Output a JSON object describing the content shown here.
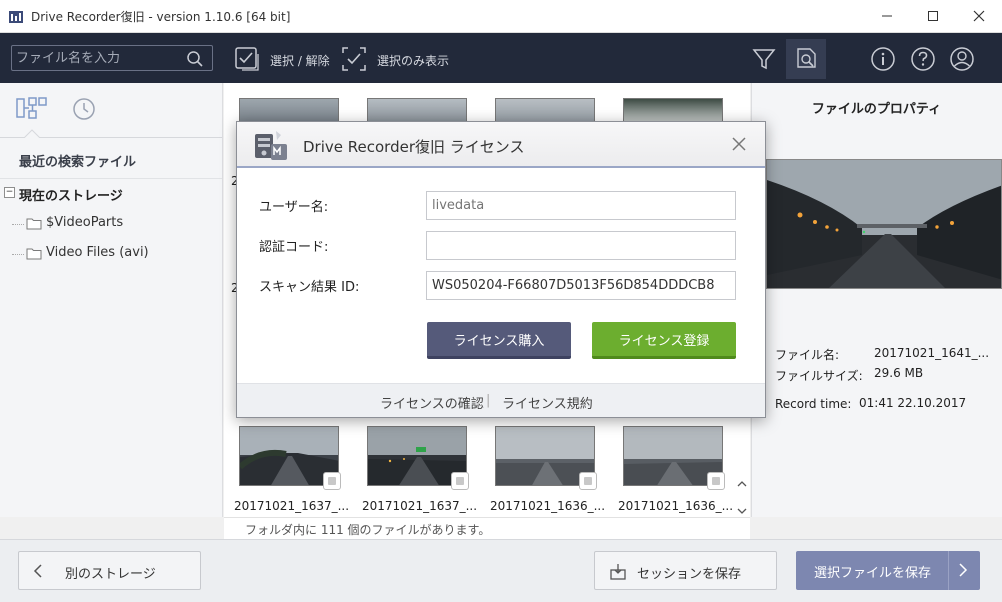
{
  "window": {
    "title": "Drive Recorder復旧 - version 1.10.6 [64 bit]"
  },
  "toolbar": {
    "search_placeholder": "ファイル名を入力",
    "select_toggle_label": "選択 / 解除",
    "show_selected_label": "選択のみ表示"
  },
  "left_panel": {
    "recent_search_label": "最近の検索ファイル",
    "current_storage_label": "現在のストレージ",
    "tree_collapse_symbol": "−",
    "folders": [
      "$VideoParts",
      "Video Files (avi)"
    ]
  },
  "grid": {
    "visible_labels": [
      "20171021_1637_...",
      "20171021_1637_...",
      "20171021_1636_...",
      "20171021_1636_..."
    ],
    "left_partial_glyphs": [
      "2",
      "2"
    ]
  },
  "status": {
    "text": "フォルダ内に 111 個のファイルがあります。"
  },
  "properties": {
    "header": "ファイルのプロパティ",
    "rows": [
      {
        "label": "ファイル名:",
        "value": "20171021_1641_..."
      },
      {
        "label": "ファイルサイズ:",
        "value": "29.6 MB"
      },
      {
        "label": "Record time:",
        "value": "01:41 22.10.2017"
      }
    ]
  },
  "bottom": {
    "back_label": "別のストレージ",
    "save_session_label": "セッションを保存",
    "save_selected_label": "選択ファイルを保存"
  },
  "dialog": {
    "title": "Drive Recorder復旧 ライセンス",
    "username_label": "ユーザー名:",
    "username_placeholder": "livedata",
    "auth_code_label": "認証コード:",
    "auth_code_value": "",
    "scan_id_label": "スキャン結果 ID:",
    "scan_id_value": "WS050204-F66807D5013F56D854DDDCB8",
    "buy_label": "ライセンス購入",
    "register_label": "ライセンス登録",
    "check_license_link": "ライセンスの確認",
    "separator": "|",
    "terms_link": "ライセンス規約"
  },
  "colors": {
    "toolbar_bg": "#22293a",
    "buy_button": "#555a7a",
    "register_button": "#6cae2f",
    "save_selected_button": "#7d87b0"
  }
}
